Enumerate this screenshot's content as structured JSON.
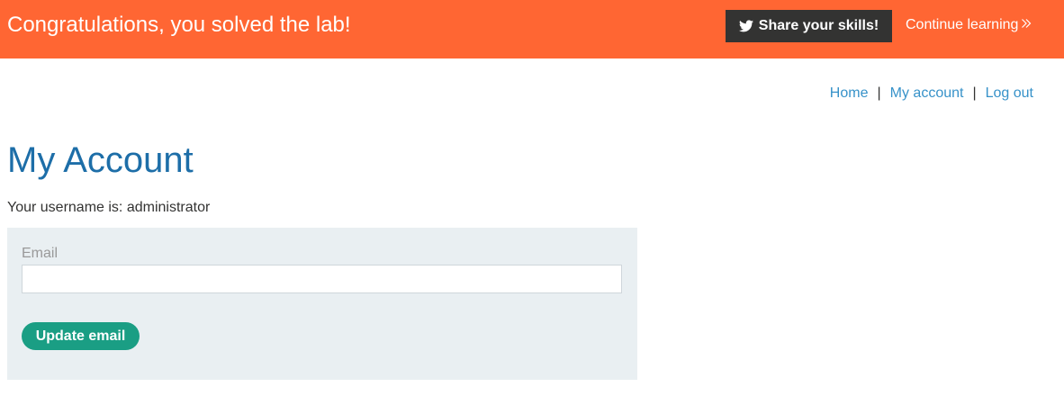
{
  "banner": {
    "title": "Congratulations, you solved the lab!",
    "share_label": "Share your skills!",
    "share_icon": "twitter-icon",
    "continue_label": "Continue learning",
    "continue_icon": "double-chevron-right-icon",
    "bg_color": "#ff6633"
  },
  "nav": {
    "home": "Home",
    "my_account": "My account",
    "log_out": "Log out",
    "separator": "|"
  },
  "main": {
    "title": "My Account",
    "username_text": "Your username is: administrator"
  },
  "form": {
    "email_label": "Email",
    "email_value": "",
    "update_label": "Update email",
    "button_color": "#1a9e84"
  }
}
